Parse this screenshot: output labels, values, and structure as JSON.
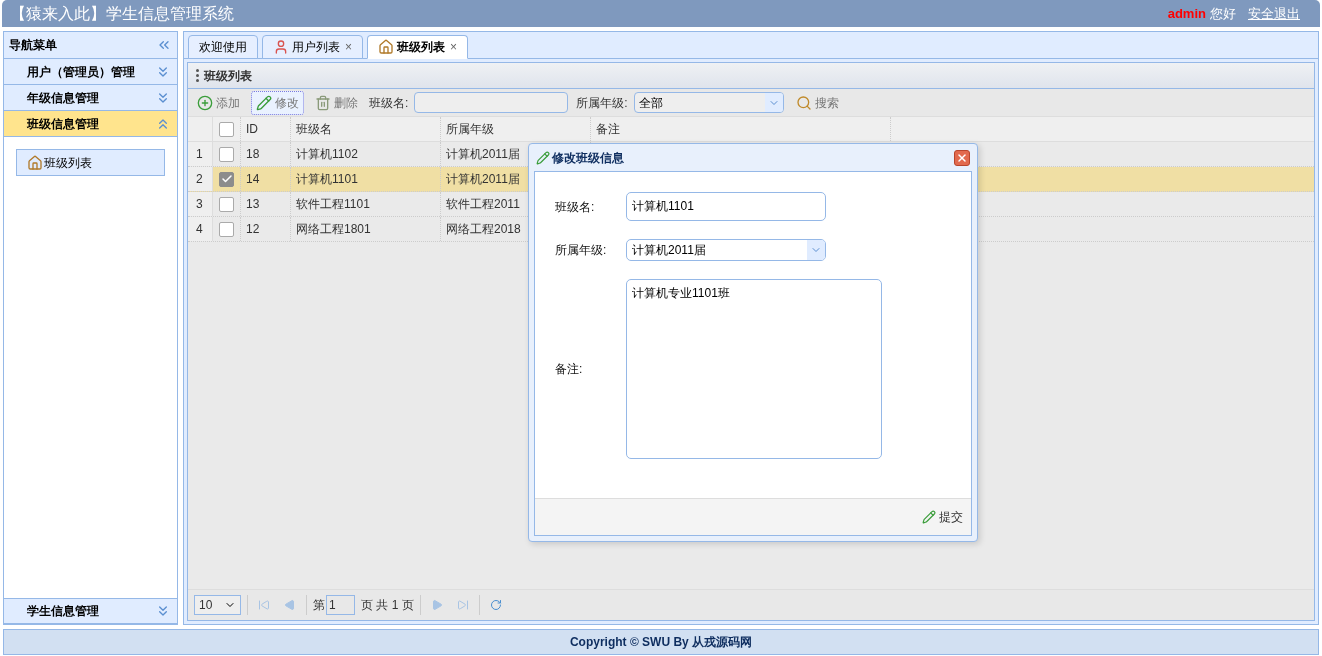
{
  "header": {
    "title": "【猿来入此】学生信息管理系统",
    "user": "admin",
    "greeting": "您好",
    "logout": "安全退出"
  },
  "sidebar": {
    "title": "导航菜单",
    "sections": [
      {
        "label": "用户（管理员）管理",
        "expanded": false
      },
      {
        "label": "年级信息管理",
        "expanded": false
      },
      {
        "label": "班级信息管理",
        "expanded": true,
        "items": [
          {
            "label": "班级列表",
            "selected": true
          }
        ]
      },
      {
        "label": "学生信息管理",
        "expanded": false
      }
    ]
  },
  "tabs": [
    {
      "label": "欢迎使用",
      "kind": "plain",
      "selected": false
    },
    {
      "label": "用户列表",
      "kind": "user",
      "close": "×",
      "selected": false
    },
    {
      "label": "班级列表",
      "kind": "house",
      "close": "×",
      "selected": true
    }
  ],
  "panel_title": "班级列表",
  "toolbar": {
    "buttons": [
      {
        "label": "添加",
        "kind": "add",
        "focused": false
      },
      {
        "label": "修改",
        "kind": "edit",
        "focused": true
      },
      {
        "label": "删除",
        "kind": "delete",
        "focused": false
      }
    ],
    "name_label": "班级名:",
    "grade_label": "所属年级:",
    "grade_value": "全部",
    "search": "搜索"
  },
  "table": {
    "header_checked": false,
    "columns": [
      "ID",
      "班级名",
      "所属年级",
      "备注"
    ],
    "rows": [
      {
        "index": "1",
        "checked": false,
        "selected": false,
        "cells": [
          "18",
          "计算机1102",
          "计算机2011届"
        ]
      },
      {
        "index": "2",
        "checked": true,
        "selected": true,
        "cells": [
          "14",
          "计算机1101",
          "计算机2011届"
        ]
      },
      {
        "index": "3",
        "checked": false,
        "selected": false,
        "cells": [
          "13",
          "软件工程1101",
          "软件工程2011"
        ]
      },
      {
        "index": "4",
        "checked": false,
        "selected": false,
        "cells": [
          "12",
          "网络工程1801",
          "网络工程2018"
        ]
      }
    ]
  },
  "pager": {
    "page_size": "10",
    "page_label": "第",
    "page": "1",
    "total": "页 共 1 页"
  },
  "dialog": {
    "title": "修改班级信息",
    "fields": [
      {
        "kind": "text",
        "label": "班级名:",
        "value": "计算机1101"
      },
      {
        "kind": "select",
        "label": "所属年级:",
        "value": "计算机2011届"
      },
      {
        "kind": "textarea",
        "label": "备注:",
        "value": "计算机专业1101班"
      }
    ],
    "submit": "提交"
  },
  "footer": "Copyright © SWU By 从戎源码网"
}
